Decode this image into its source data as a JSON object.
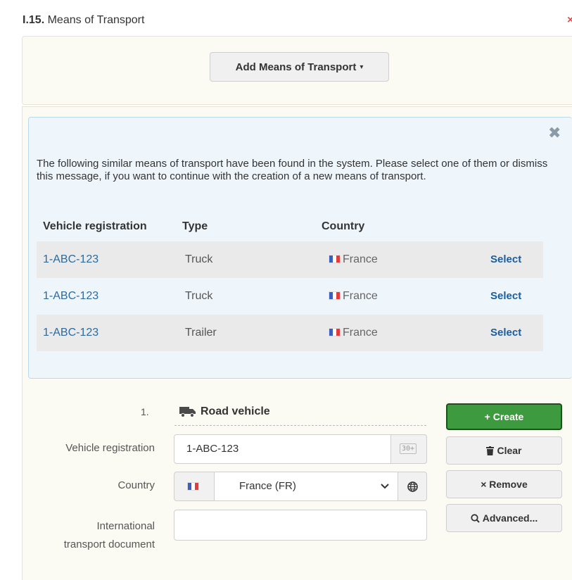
{
  "section": {
    "number": "I.15.",
    "title": "Means of Transport",
    "close": "×"
  },
  "add_button": {
    "label": "Add Means of Transport",
    "caret": "▾"
  },
  "alert": {
    "close": "✖",
    "message": "The following similar means of transport have been found in the system. Please select one of them or dismiss this message, if you want to continue with the creation of a new means of transport.",
    "headers": {
      "registration": "Vehicle registration",
      "type": "Type",
      "country": "Country"
    },
    "rows": [
      {
        "registration": "1-ABC-123",
        "type": "Truck",
        "country": "France",
        "action": "Select"
      },
      {
        "registration": "1-ABC-123",
        "type": "Truck",
        "country": "France",
        "action": "Select"
      },
      {
        "registration": "1-ABC-123",
        "type": "Trailer",
        "country": "France",
        "action": "Select"
      }
    ]
  },
  "form": {
    "index": "1.",
    "vehicle_type": "Road vehicle",
    "vehicle_icon": "truck-icon",
    "registration": {
      "label": "Vehicle registration",
      "value": "1-ABC-123",
      "badge": "30+"
    },
    "country": {
      "label": "Country",
      "value": "France (FR)",
      "flag": "france-flag-icon",
      "globe": "globe-icon"
    },
    "document": {
      "label_line1": "International",
      "label_line2": "transport document",
      "value": ""
    }
  },
  "actions": {
    "create": "+ Create",
    "clear": "Clear",
    "remove": "× Remove",
    "advanced": "Advanced..."
  },
  "colors": {
    "create_bg": "#3e9a3e",
    "link": "#2c6aa0",
    "alert_bg": "#eef6fc",
    "close_red": "#d9534f"
  }
}
